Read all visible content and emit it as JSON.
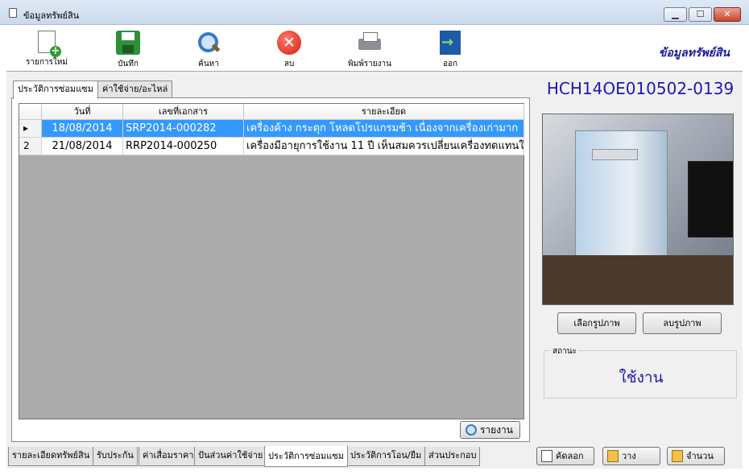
{
  "window": {
    "title": "ข้อมูลทรัพย์สิน",
    "min_glyph": "▁",
    "max_glyph": "☐",
    "close_glyph": "✕"
  },
  "toolbar": {
    "new_label": "รายการใหม่",
    "save_label": "บันทึก",
    "search_label": "ค้นหา",
    "delete_label": "ลบ",
    "print_label": "พิมพ์รายงาน",
    "exit_label": "ออก",
    "app_title": "ข้อมูลทรัพย์สิน",
    "delete_glyph": "✕"
  },
  "upper_tabs": [
    "ประวัติการซ่อมแซม",
    "ค่าใช้จ่าย/อะไหล่"
  ],
  "grid": {
    "columns": [
      "วันที่",
      "เลขที่เอกสาร",
      "รายละเอียด"
    ],
    "rows": [
      {
        "row_header": "▸",
        "date": "18/08/2014",
        "doc_no": "SRP2014-000282",
        "detail": "เครื่องค้าง กระตุก โหลดโปรแกรมช้า เนื่องจากเครื่องเก่ามาก"
      },
      {
        "row_header": "2",
        "date": "21/08/2014",
        "doc_no": "RRP2014-000250",
        "detail": "เครื่องมีอายุการใช้งาน 11 ปี เห็นสมควรเปลี่ยนเครื่องทดแทนใ..."
      }
    ]
  },
  "report_button": "รายงาน",
  "bottom_tabs": [
    "รายละเอียดทรัพย์สิน",
    "รับประกัน",
    "ค่าเสื่อมราคา",
    "ปันส่วนค่าใช้จ่าย",
    "ประวัติการซ่อมแซม",
    "ประวัติการโอน/ยืม",
    "ส่วนประกอบ"
  ],
  "asset": {
    "code": "HCH14OE010502-0139",
    "select_image": "เลือกรูปภาพ",
    "delete_image": "ลบรูปภาพ",
    "status_label": "สถานะ",
    "status_value": "ใช้งาน"
  },
  "bottom_buttons": {
    "copy": "คัดลอก",
    "paste": "วาง",
    "count": "จำนวน"
  },
  "colors": {
    "selected_row": "#3399ff",
    "accent_text": "#1a1ab0"
  }
}
